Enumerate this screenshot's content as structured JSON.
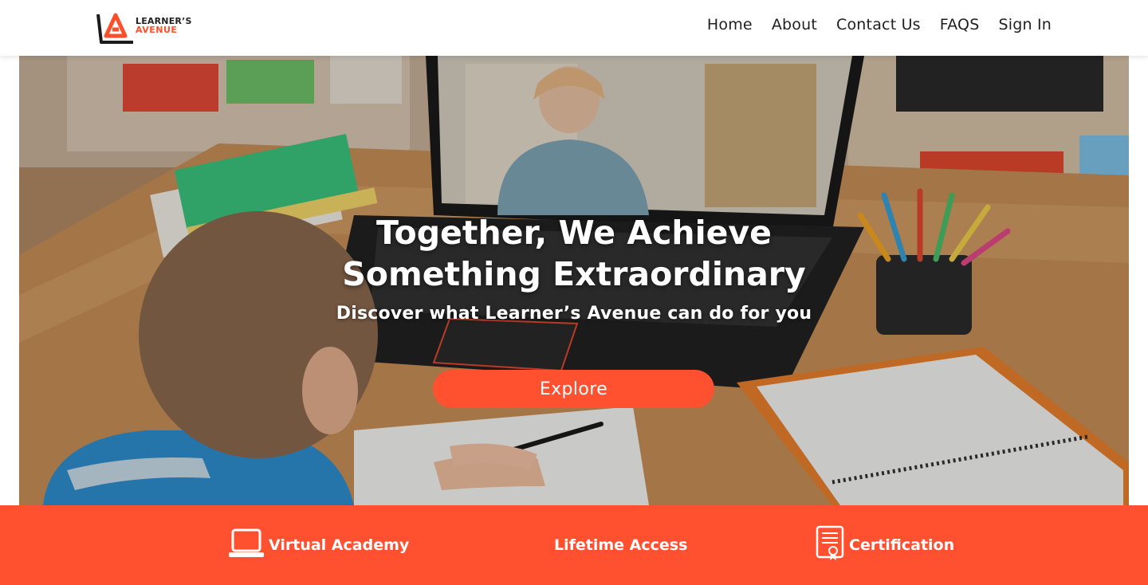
{
  "brand": {
    "line1": "LEARNER’S",
    "line2": "AVENUE",
    "accent_color": "#ff5030",
    "logo_icon": "la-monogram-logo"
  },
  "nav": {
    "items": [
      {
        "label": "Home"
      },
      {
        "label": "About"
      },
      {
        "label": "Contact Us"
      },
      {
        "label": "FAQS"
      },
      {
        "label": "Sign In"
      }
    ]
  },
  "hero": {
    "title_line1": "Together, We Achieve",
    "title_line2": "Something Extraordinary",
    "subtitle": "Discover what Learner’s Avenue can do for you",
    "cta_label": "Explore",
    "image": "child-in-online-class-with-laptop-photo"
  },
  "features": {
    "bar_color": "#ff512f",
    "items": [
      {
        "label": "Virtual Academy",
        "icon": "laptop-icon"
      },
      {
        "label": "Lifetime Access",
        "icon": ""
      },
      {
        "label": "Certification",
        "icon": "certificate-icon"
      }
    ]
  }
}
